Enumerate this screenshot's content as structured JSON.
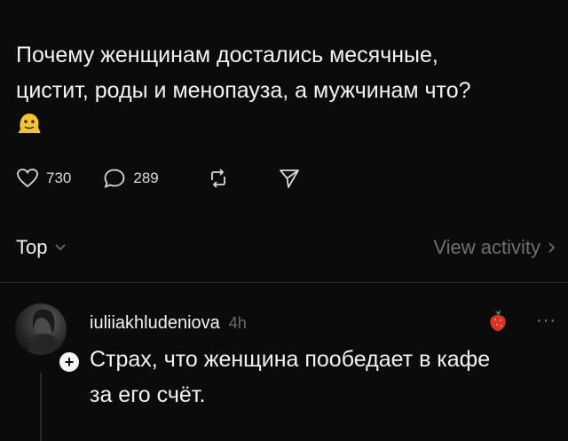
{
  "post": {
    "text_line1": "Почему женщинам достались месячные,",
    "text_line2": "цистит, роды и менопауза, а мужчинам что?",
    "emoji": "melting-face-emoji"
  },
  "actions": {
    "likes": "730",
    "replies": "289"
  },
  "sort": {
    "label": "Top",
    "view_activity": "View activity"
  },
  "reply": {
    "username": "iuliiakhludeniova",
    "time": "4h",
    "text_line1": "Страх, что женщина пообедает в кафе",
    "text_line2": "за его счёт."
  },
  "colors": {
    "background": "#0b0b0b",
    "text": "#f2f2f2",
    "muted": "#6f6f6f"
  }
}
